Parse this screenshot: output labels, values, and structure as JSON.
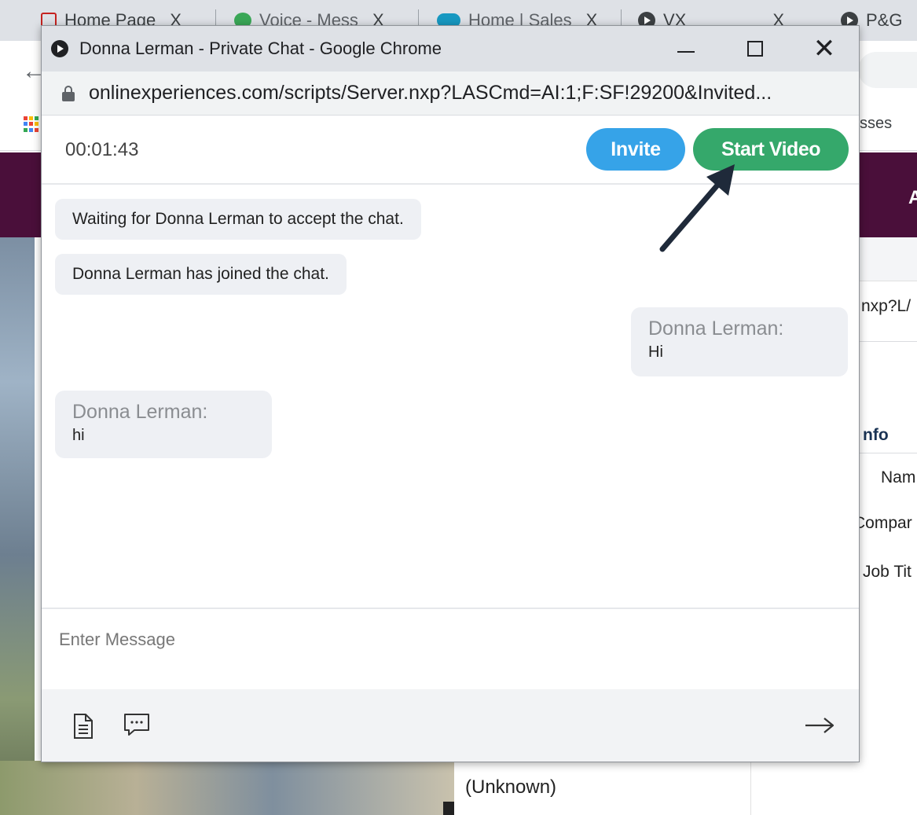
{
  "background_browser": {
    "tabs": [
      {
        "label": "Home Page",
        "icon": "document-icon",
        "close": "X"
      },
      {
        "label": "Voice - Mess",
        "icon": "voice-icon",
        "close": "X"
      },
      {
        "label": "Home | Sales",
        "icon": "salesforce-cloud-icon",
        "close": "X"
      },
      {
        "label": "VX",
        "icon": "play-circle-icon",
        "close": "X"
      },
      {
        "label": "P&G",
        "icon": "play-circle-icon"
      }
    ],
    "bookmark_text": "sses",
    "right_panel": {
      "url_fragment": "nxp?L/",
      "section_label": "nfo",
      "field_name": "Nam",
      "field_company": "Compar",
      "field_job": "Job Tit"
    },
    "contact_status": "(Unknown)"
  },
  "popup": {
    "window_title": "Donna Lerman - Private Chat - Google Chrome",
    "url": "onlinexperiences.com/scripts/Server.nxp?LASCmd=AI:1;F:SF!29200&Invited...",
    "controls": {
      "minimize": "minimize",
      "maximize": "maximize",
      "close": "close"
    }
  },
  "chat": {
    "timer": "00:01:43",
    "invite_label": "Invite",
    "start_video_label": "Start Video",
    "system_messages": [
      "Waiting for Donna Lerman to accept the chat.",
      "Donna Lerman has joined the chat."
    ],
    "messages": [
      {
        "sender": "Donna Lerman:",
        "text": "Hi",
        "align": "right"
      },
      {
        "sender": "Donna Lerman:",
        "text": "hi",
        "align": "left"
      }
    ],
    "input_placeholder": "Enter Message",
    "footer_icons": [
      "document-icon",
      "comment-icon",
      "send-arrow-icon"
    ]
  },
  "colors": {
    "invite": "#36a3e8",
    "start_video": "#35a86b",
    "banner_purple": "#4a0f3a",
    "bubble": "#eef0f4"
  }
}
